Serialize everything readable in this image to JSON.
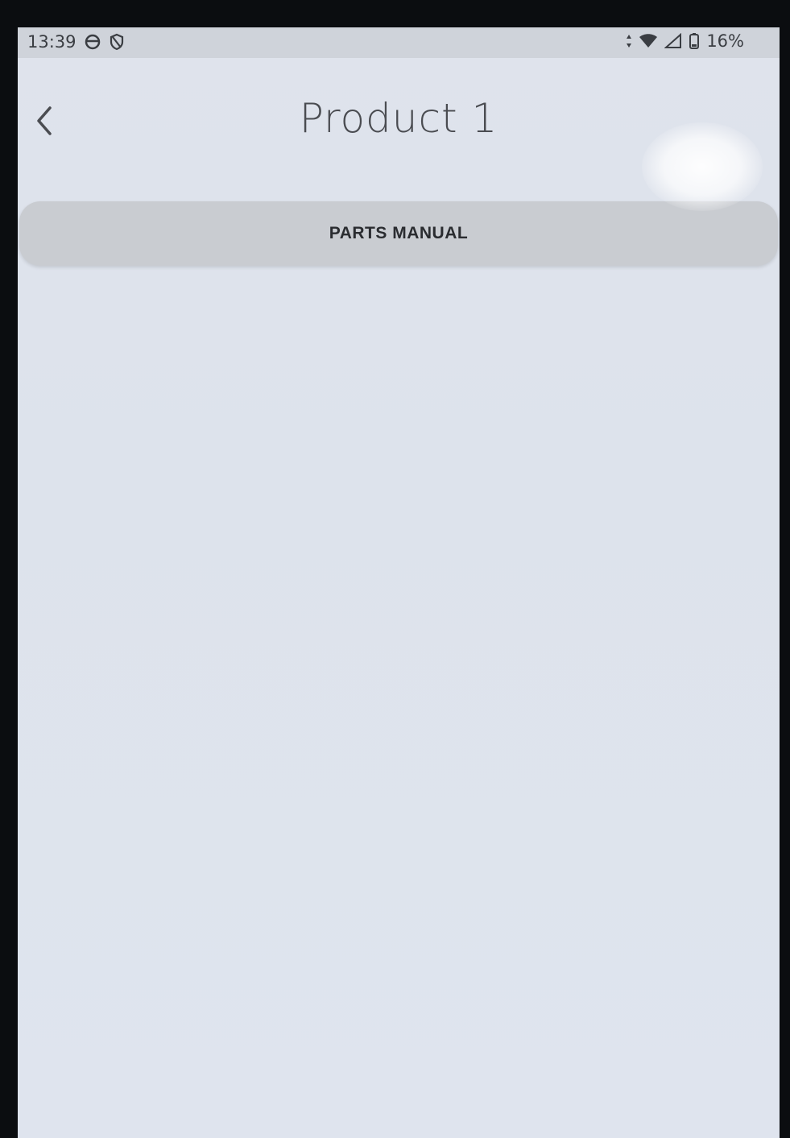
{
  "status_bar": {
    "time": "13:39",
    "left_icons": [
      "circle-status-icon",
      "shield-status-icon"
    ],
    "right_icons": [
      "data-transfer-icon",
      "wifi-icon",
      "cell-signal-icon",
      "battery-icon"
    ],
    "battery_percent": "16%"
  },
  "header": {
    "back_icon": "chevron-left-icon",
    "title": "Product 1"
  },
  "actions": {
    "parts_manual_label": "PARTS MANUAL"
  },
  "colors": {
    "background": "#dfe3ec",
    "status_bar": "#cfd3da",
    "button": "#c9ccd1",
    "title_text": "#4a4c51"
  }
}
